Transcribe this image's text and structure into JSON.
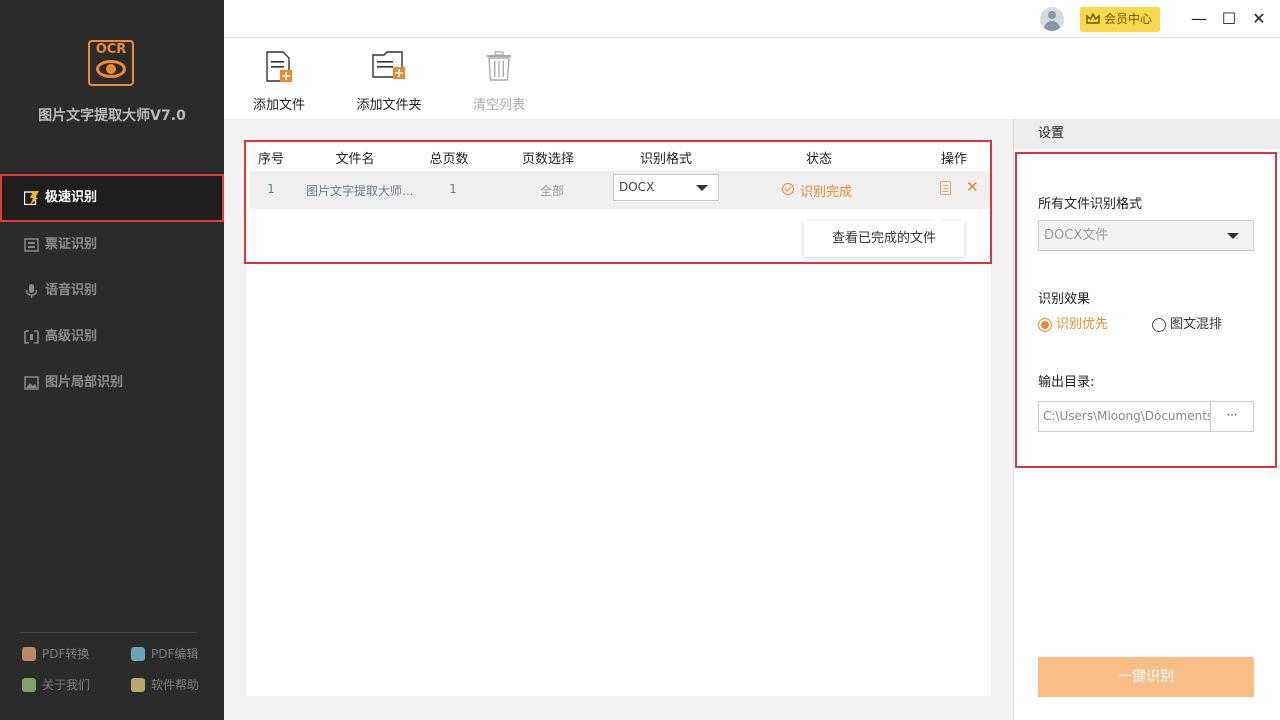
{
  "app": {
    "logo_text": "OCR",
    "name": "图片文字提取大师V7.0"
  },
  "sidebar": {
    "items": [
      {
        "label": "极速识别",
        "active": true
      },
      {
        "label": "票证识别"
      },
      {
        "label": "语音识别"
      },
      {
        "label": "高级识别"
      },
      {
        "label": "图片局部识别"
      }
    ],
    "footer": [
      {
        "label": "PDF转换"
      },
      {
        "label": "PDF编辑"
      },
      {
        "label": "关于我们"
      },
      {
        "label": "软件帮助"
      }
    ]
  },
  "titlebar": {
    "vip_label": "会员中心",
    "minimize": "—",
    "maximize": "☐",
    "close": "✕"
  },
  "toolbar": {
    "add_file": "添加文件",
    "add_folder": "添加文件夹",
    "clear_list": "清空列表"
  },
  "table": {
    "headers": [
      "序号",
      "文件名",
      "总页数",
      "页数选择",
      "识别格式",
      "状态",
      "操作"
    ],
    "rows": [
      {
        "index": "1",
        "filename": "图片文字提取大师...",
        "total_pages": "1",
        "page_select": "全部",
        "format": "DOCX",
        "status": "识别完成"
      }
    ],
    "tooltip": "查看已完成的文件"
  },
  "settings": {
    "header": "设置",
    "format_label": "所有文件识别格式",
    "format_value": "DOCX文件",
    "effect_label": "识别效果",
    "effect_options": [
      {
        "label": "识别优先",
        "checked": true
      },
      {
        "label": "图文混排",
        "checked": false
      }
    ],
    "output_label": "输出目录:",
    "output_path": "C:\\Users\\Mloong\\Documents",
    "browse": "···",
    "run_button": "一键识别"
  },
  "colors": {
    "accent": "#f0882c",
    "highlight": "#d9363e",
    "sidebar_bg": "#2b2b2b"
  }
}
